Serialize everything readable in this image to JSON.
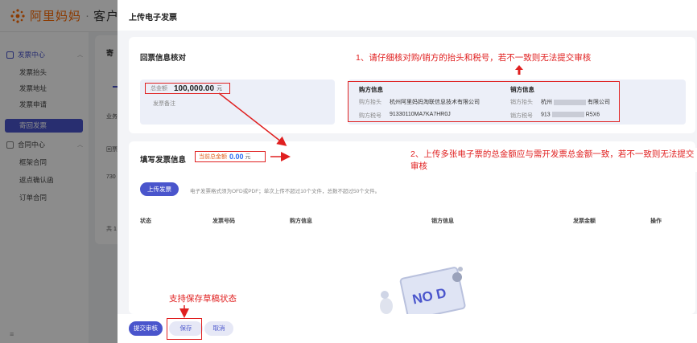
{
  "app": {
    "brand": "阿里妈妈",
    "separator": "·",
    "workspace": "客户工作台"
  },
  "sidebar": {
    "groups": [
      {
        "label": "发票中心",
        "items": [
          "发票抬头",
          "发票地址",
          "发票申请",
          "寄回发票"
        ]
      },
      {
        "label": "合同中心",
        "items": [
          "框架合同",
          "返点确认函",
          "订单合同"
        ]
      }
    ],
    "active_item": "寄回发票",
    "footer_icon": "menu-icon"
  },
  "background_card": {
    "title": "寄",
    "row1": "业务",
    "row2": "回票",
    "row3": "730",
    "row4": "共 1"
  },
  "drawer": {
    "title": "上传电子发票",
    "verify": {
      "title": "回票信息核对",
      "total_label": "总金额",
      "total_value": "100,000.00",
      "total_unit": "元",
      "note_label": "发票备注",
      "buyer_head": "购方信息",
      "seller_head": "销方信息",
      "buyer_title_label": "购方抬头",
      "buyer_title_value": "杭州阿里妈妈淘联信息技术有限公司",
      "buyer_tax_label": "购方税号",
      "buyer_tax_value": "91330110MA7KA7HR0J",
      "seller_title_label": "销方抬头",
      "seller_title_prefix": "杭州",
      "seller_title_suffix": "有限公司",
      "seller_tax_label": "销方税号",
      "seller_tax_prefix": "913",
      "seller_tax_suffix": "R5X6"
    },
    "invoice": {
      "title": "填写发票信息",
      "current_label": "当前总金额",
      "current_value": "0.00",
      "current_unit": "元",
      "upload_button": "上传发票",
      "upload_tip": "电子发票格式须为OFD或PDF；单次上传不超过10个文件，总数不超过50个文件。",
      "columns": [
        "状态",
        "发票号码",
        "购方信息",
        "销方信息",
        "发票金额",
        "操作"
      ],
      "empty_text": "NO D"
    },
    "footer": {
      "submit": "提交审核",
      "save": "保存",
      "cancel": "取消"
    }
  },
  "annotations": {
    "a1": "1、请仔细核对购/销方的抬头和税号，若不一致则无法提交审核",
    "a2": "2、上传多张电子票的总金额应与需开发票总金额一致，若不一致则无法提交审核",
    "a3": "支持保存草稿状态"
  },
  "colors": {
    "primary": "#4a55cc",
    "annotation": "#e02020",
    "brand": "#ff6a00"
  }
}
